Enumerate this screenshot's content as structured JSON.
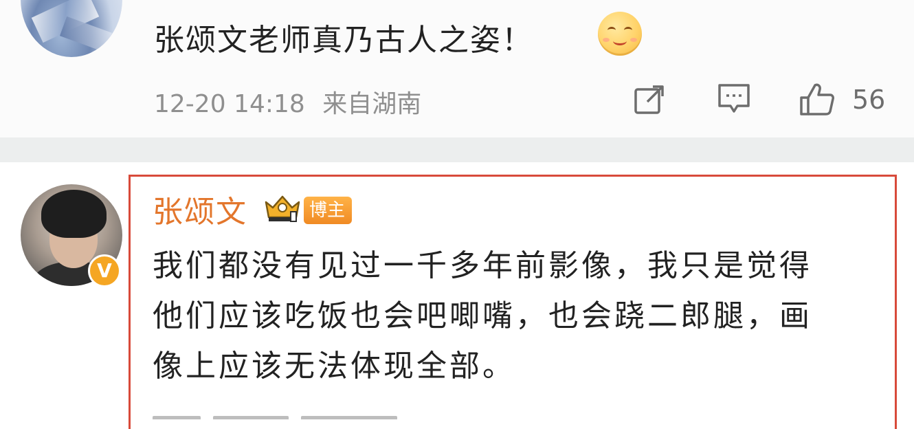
{
  "top_comment": {
    "text": "张颂文老师真乃古人之姿！",
    "emoji": "smile-emoji",
    "timestamp": "12-20 14:18",
    "location": "来自湖南",
    "like_count": "56"
  },
  "reply": {
    "username": "张颂文",
    "badge_label": "博主",
    "verified_mark": "V",
    "text_lines": [
      "我们都没有见过一千多年前影像，我只是觉得",
      "他们应该吃饭也会吧唧嘴，也会跷二郎腿，画",
      "像上应该无法体现全部。"
    ]
  },
  "colors": {
    "highlight_border": "#d84a3a",
    "username": "#e3762c",
    "badge": "#f08a24",
    "meta_text": "#8f8f8f",
    "separator": "#eceeee"
  },
  "icons": {
    "share": "share-icon",
    "reply": "comment-icon",
    "like": "thumbs-up-icon",
    "crown": "crown-badge-icon",
    "verified": "verified-v-icon"
  }
}
